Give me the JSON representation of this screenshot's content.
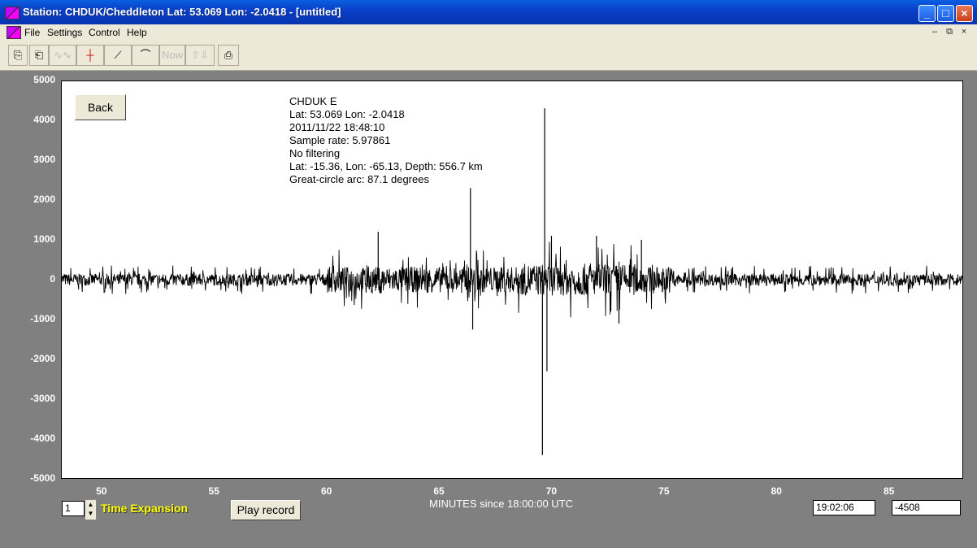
{
  "window": {
    "title": "Station: CHDUK/Cheddleton Lat: 53.069 Lon: -2.0418 - [untitled]"
  },
  "menu": [
    "File",
    "Settings",
    "Control",
    "Help"
  ],
  "toolbar": {
    "now_label": "Now"
  },
  "buttons": {
    "back": "Back",
    "play": "Play record"
  },
  "info": {
    "station": "CHDUK  E",
    "location": "Lat: 53.069 Lon: -2.0418",
    "datetime": "2011/11/22 18:48:10",
    "sample_rate": "Sample rate: 5.97861",
    "filter": "No filtering",
    "event": "Lat: -15.36, Lon: -65.13, Depth: 556.7 km",
    "arc": "Great-circle arc: 87.1 degrees"
  },
  "bottom": {
    "expansion_value": "1",
    "expansion_label": "Time Expansion",
    "xaxis_label": "MINUTES since 18:00:00 UTC",
    "time_readout": "19:02:06",
    "value_readout": "-4508"
  },
  "colors": {
    "titlebar": "#0a4fd8",
    "background": "#808080",
    "expansion_label": "#ffff00",
    "trace": "#000000"
  },
  "chart_data": {
    "type": "line",
    "xlabel": "MINUTES since 18:00:00 UTC",
    "xlim": [
      48.2,
      88.3
    ],
    "ylim": [
      -5000,
      5000
    ],
    "y_ticks": [
      "5000",
      "4000",
      "3000",
      "2000",
      "1000",
      "0",
      "-1000",
      "-2000",
      "-3000",
      "-4000",
      "-5000"
    ],
    "x_ticks": [
      "50",
      "55",
      "60",
      "65",
      "70",
      "75",
      "80",
      "85"
    ],
    "series": [
      {
        "x": [
          48.2,
          50,
          52,
          54,
          56,
          58,
          60,
          60.1,
          61,
          62,
          62.3,
          63,
          64,
          65,
          66,
          66.4,
          66.5,
          67,
          68,
          69,
          69.6,
          69.7,
          69.8,
          70,
          71,
          72,
          73,
          74,
          75,
          78,
          80,
          82,
          84,
          85,
          87,
          88.3
        ],
        "y": [
          0,
          300,
          -300,
          250,
          -250,
          250,
          -150,
          900,
          -600,
          800,
          1200,
          -900,
          900,
          -800,
          700,
          2300,
          -1250,
          800,
          -600,
          600,
          -4400,
          4300,
          -2300,
          1100,
          -900,
          1100,
          -1100,
          1000,
          -800,
          700,
          -600,
          700,
          -500,
          600,
          -600,
          0
        ]
      }
    ]
  }
}
